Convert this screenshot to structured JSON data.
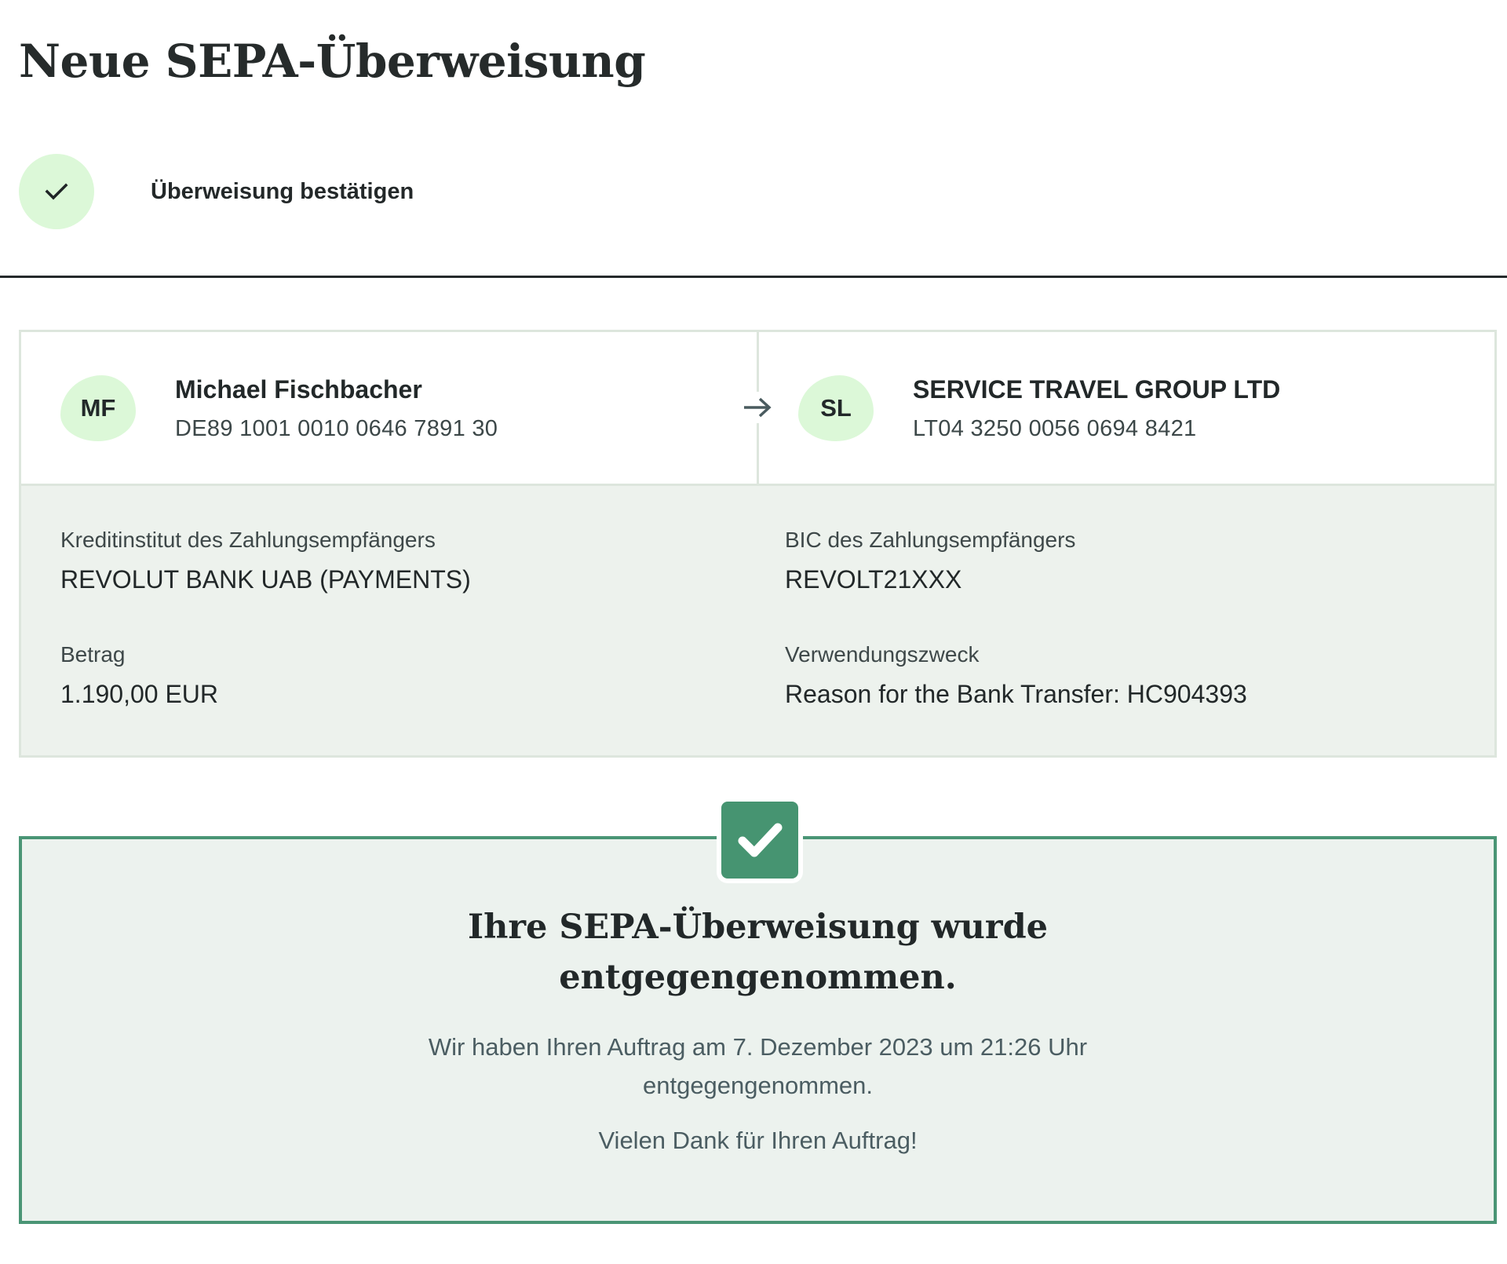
{
  "page": {
    "title": "Neue SEPA-Überweisung"
  },
  "step": {
    "icon": "checkmark-icon",
    "label": "Überweisung bestätigen"
  },
  "sender": {
    "initials": "MF",
    "name": "Michael Fischbacher",
    "iban": "DE89 1001 0010 0646 7891 30"
  },
  "recipient": {
    "initials": "SL",
    "name": "SERVICE TRAVEL GROUP LTD",
    "iban": "LT04 3250 0056 0694 8421"
  },
  "transfer_arrow_icon": "arrow-right-icon",
  "details": {
    "bank_label": "Kreditinstitut des Zahlungsempfängers",
    "bank_value": "REVOLUT BANK UAB (PAYMENTS)",
    "bic_label": "BIC des Zahlungsempfängers",
    "bic_value": "REVOLT21XXX",
    "amount_label": "Betrag",
    "amount_value": "1.190,00 EUR",
    "purpose_label": "Verwendungszweck",
    "purpose_value": "Reason for the Bank Transfer: HC904393"
  },
  "success": {
    "icon": "checkmark-badge-icon",
    "title_line1": "Ihre SEPA-Überweisung wurde",
    "title_line2": "entgegengenommen.",
    "message_line1": "Wir haben Ihren Auftrag am 7. Dezember 2023 um 21:26 Uhr",
    "message_line2": "entgegengenommen.",
    "thanks": "Vielen Dank für Ihren Auftrag!"
  },
  "colors": {
    "accent_green": "#469471",
    "light_green": "#dcf8d8",
    "panel_bg": "#edf2ed",
    "text_dark": "#222829"
  }
}
